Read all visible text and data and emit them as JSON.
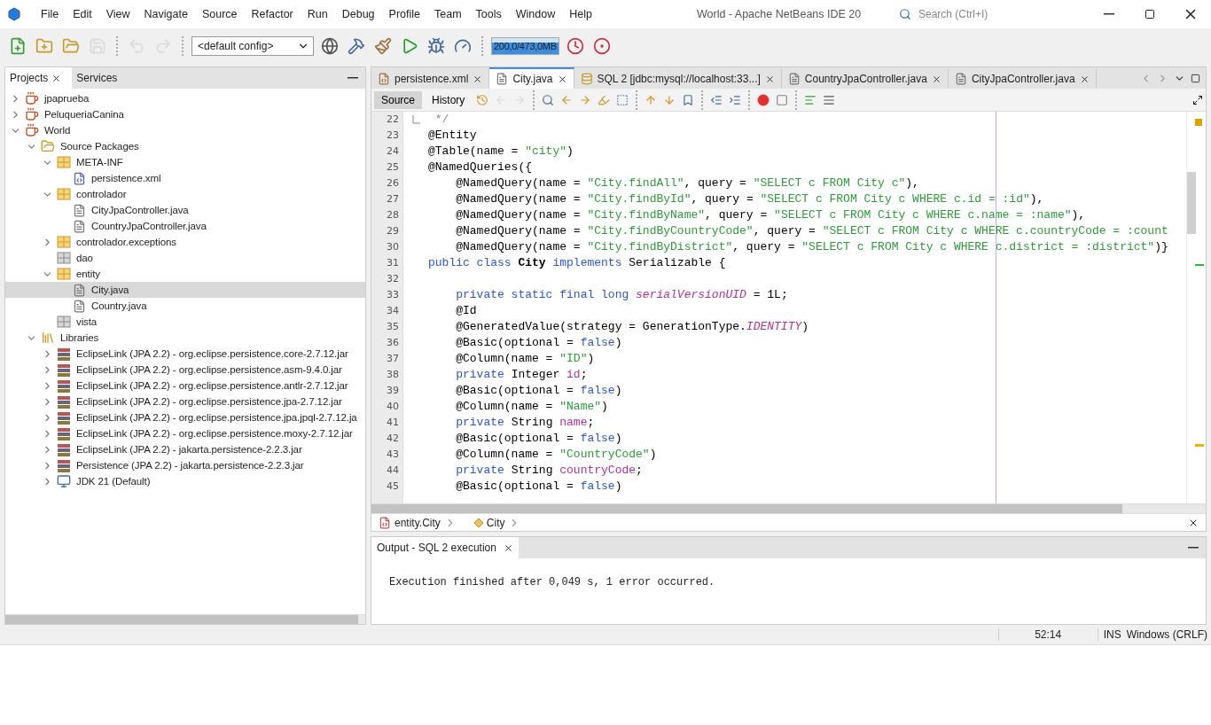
{
  "window": {
    "title": "World - Apache NetBeans IDE 20",
    "search_placeholder": "Search (Ctrl+I)"
  },
  "menu": [
    "File",
    "Edit",
    "View",
    "Navigate",
    "Source",
    "Refactor",
    "Run",
    "Debug",
    "Profile",
    "Team",
    "Tools",
    "Window",
    "Help"
  ],
  "toolbar": {
    "buttons": [
      {
        "kind": "new-file",
        "disabled": false
      },
      {
        "kind": "new-project",
        "disabled": false
      },
      {
        "kind": "open-project",
        "disabled": false
      },
      {
        "kind": "save-all",
        "disabled": true
      },
      {
        "kind": "sep"
      },
      {
        "kind": "undo",
        "disabled": true
      },
      {
        "kind": "redo",
        "disabled": true
      },
      {
        "kind": "sep"
      },
      {
        "kind": "config"
      },
      {
        "kind": "globe",
        "disabled": false
      },
      {
        "kind": "build",
        "disabled": false
      },
      {
        "kind": "clean-build",
        "disabled": false
      },
      {
        "kind": "run",
        "disabled": false
      },
      {
        "kind": "debug",
        "disabled": false
      },
      {
        "kind": "profile",
        "disabled": false
      },
      {
        "kind": "sep"
      },
      {
        "kind": "memory"
      },
      {
        "kind": "profiler-a",
        "disabled": false
      },
      {
        "kind": "profiler-b",
        "disabled": false
      }
    ],
    "config": "<default config>",
    "memory": "200,0/473,0MB"
  },
  "project_panel": {
    "tabs": [
      {
        "label": "Projects",
        "selected": true
      },
      {
        "label": "Services",
        "selected": false
      }
    ],
    "tree": [
      {
        "label": "jpaprueba",
        "kind": "project",
        "expanded": false,
        "selected": false
      },
      {
        "label": "PeluqueriaCanina",
        "kind": "project",
        "expanded": false,
        "selected": false
      },
      {
        "label": "World",
        "kind": "project",
        "expanded": true,
        "selected": false,
        "children": [
          {
            "label": "Source Packages",
            "kind": "source-packages",
            "expanded": true,
            "selected": false,
            "children": [
              {
                "label": "META-INF",
                "kind": "package",
                "expanded": true,
                "selected": false,
                "children": [
                  {
                    "label": "persistence.xml",
                    "kind": "xml-file",
                    "selected": false
                  }
                ]
              },
              {
                "label": "controlador",
                "kind": "package",
                "expanded": true,
                "selected": false,
                "children": [
                  {
                    "label": "CityJpaController.java",
                    "kind": "java-file",
                    "selected": false
                  },
                  {
                    "label": "CountryJpaController.java",
                    "kind": "java-file",
                    "selected": false
                  }
                ]
              },
              {
                "label": "controlador.exceptions",
                "kind": "package",
                "expanded": false,
                "selected": false
              },
              {
                "label": "dao",
                "kind": "empty-package",
                "selected": false
              },
              {
                "label": "entity",
                "kind": "package",
                "expanded": true,
                "selected": false,
                "children": [
                  {
                    "label": "City.java",
                    "kind": "java-file",
                    "selected": true
                  },
                  {
                    "label": "Country.java",
                    "kind": "java-file",
                    "selected": false
                  }
                ]
              },
              {
                "label": "vista",
                "kind": "empty-package",
                "selected": false
              }
            ]
          },
          {
            "label": "Libraries",
            "kind": "libraries",
            "expanded": true,
            "selected": false,
            "children": [
              {
                "label": "EclipseLink (JPA 2.2) - org.eclipse.persistence.core-2.7.12.jar",
                "kind": "jar",
                "expanded": false,
                "selected": false
              },
              {
                "label": "EclipseLink (JPA 2.2) - org.eclipse.persistence.asm-9.4.0.jar",
                "kind": "jar",
                "expanded": false,
                "selected": false
              },
              {
                "label": "EclipseLink (JPA 2.2) - org.eclipse.persistence.antlr-2.7.12.jar",
                "kind": "jar",
                "expanded": false,
                "selected": false
              },
              {
                "label": "EclipseLink (JPA 2.2) - org.eclipse.persistence.jpa-2.7.12.jar",
                "kind": "jar",
                "expanded": false,
                "selected": false
              },
              {
                "label": "EclipseLink (JPA 2.2) - org.eclipse.persistence.jpa.jpql-2.7.12.ja",
                "kind": "jar",
                "expanded": false,
                "selected": false
              },
              {
                "label": "EclipseLink (JPA 2.2) - org.eclipse.persistence.moxy-2.7.12.jar",
                "kind": "jar",
                "expanded": false,
                "selected": false
              },
              {
                "label": "EclipseLink (JPA 2.2) - jakarta.persistence-2.2.3.jar",
                "kind": "jar",
                "expanded": false,
                "selected": false
              },
              {
                "label": "Persistence (JPA 2.2) - jakarta.persistence-2.2.3.jar",
                "kind": "jar",
                "expanded": false,
                "selected": false
              },
              {
                "label": "JDK 21 (Default)",
                "kind": "jdk",
                "expanded": false,
                "selected": false
              }
            ]
          }
        ]
      }
    ]
  },
  "editor": {
    "tabs": [
      {
        "label": "persistence.xml",
        "kind": "xml",
        "selected": false
      },
      {
        "label": "City.java",
        "kind": "java",
        "selected": true
      },
      {
        "label": "SQL 2 [jdbc:mysql://localhost:33...]",
        "kind": "sql",
        "selected": false
      },
      {
        "label": "CountryJpaController.java",
        "kind": "java",
        "selected": false
      },
      {
        "label": "CityJpaController.java",
        "kind": "java",
        "selected": false
      }
    ],
    "view_tabs": [
      {
        "label": "Source",
        "selected": true
      },
      {
        "label": "History",
        "selected": false
      }
    ],
    "tools": [
      {
        "kind": "last-edit",
        "disabled": false
      },
      {
        "kind": "back",
        "disabled": true
      },
      {
        "kind": "forward",
        "disabled": true
      },
      {
        "kind": "sep"
      },
      {
        "kind": "find",
        "disabled": false
      },
      {
        "kind": "find-prev",
        "disabled": false
      },
      {
        "kind": "find-next",
        "disabled": false
      },
      {
        "kind": "highlight",
        "disabled": false
      },
      {
        "kind": "rect-select",
        "disabled": false
      },
      {
        "kind": "sep"
      },
      {
        "kind": "prev-bookmark",
        "disabled": false
      },
      {
        "kind": "next-bookmark",
        "disabled": false
      },
      {
        "kind": "toggle-bookmark",
        "disabled": false
      },
      {
        "kind": "sep"
      },
      {
        "kind": "shift-left",
        "disabled": false
      },
      {
        "kind": "shift-right",
        "disabled": false
      },
      {
        "kind": "sep"
      },
      {
        "kind": "record",
        "disabled": false
      },
      {
        "kind": "stop",
        "disabled": false
      },
      {
        "kind": "sep"
      },
      {
        "kind": "comment",
        "disabled": false
      },
      {
        "kind": "uncomment",
        "disabled": false
      }
    ],
    "lines": [
      {
        "n": "22",
        "fold": true,
        "tokens": [
          {
            "kind": "c",
            "text": " */"
          }
        ]
      },
      {
        "n": "23",
        "tokens": [
          {
            "kind": "p",
            "text": "@Entity"
          }
        ]
      },
      {
        "n": "24",
        "tokens": [
          {
            "kind": "p",
            "text": "@Table(name = "
          },
          {
            "kind": "s",
            "text": "\"city\""
          },
          {
            "kind": "p",
            "text": ")"
          }
        ]
      },
      {
        "n": "25",
        "tokens": [
          {
            "kind": "p",
            "text": "@NamedQueries({"
          }
        ]
      },
      {
        "n": "26",
        "tokens": [
          {
            "kind": "p",
            "text": "    @NamedQuery(name = "
          },
          {
            "kind": "s",
            "text": "\"City.findAll\""
          },
          {
            "kind": "p",
            "text": ", query = "
          },
          {
            "kind": "s",
            "text": "\"SELECT c FROM City c\""
          },
          {
            "kind": "p",
            "text": "),"
          }
        ]
      },
      {
        "n": "27",
        "tokens": [
          {
            "kind": "p",
            "text": "    @NamedQuery(name = "
          },
          {
            "kind": "s",
            "text": "\"City.findById\""
          },
          {
            "kind": "p",
            "text": ", query = "
          },
          {
            "kind": "s",
            "text": "\"SELECT c FROM City c WHERE c.id = :id\""
          },
          {
            "kind": "p",
            "text": "),"
          }
        ]
      },
      {
        "n": "28",
        "tokens": [
          {
            "kind": "p",
            "text": "    @NamedQuery(name = "
          },
          {
            "kind": "s",
            "text": "\"City.findByName\""
          },
          {
            "kind": "p",
            "text": ", query = "
          },
          {
            "kind": "s",
            "text": "\"SELECT c FROM City c WHERE c.name = :name\""
          },
          {
            "kind": "p",
            "text": "),"
          }
        ]
      },
      {
        "n": "29",
        "tokens": [
          {
            "kind": "p",
            "text": "    @NamedQuery(name = "
          },
          {
            "kind": "s",
            "text": "\"City.findByCountryCode\""
          },
          {
            "kind": "p",
            "text": ", query = "
          },
          {
            "kind": "s",
            "text": "\"SELECT c FROM City c WHERE c.countryCode = :count"
          }
        ]
      },
      {
        "n": "30",
        "tokens": [
          {
            "kind": "p",
            "text": "    @NamedQuery(name = "
          },
          {
            "kind": "s",
            "text": "\"City.findByDistrict\""
          },
          {
            "kind": "p",
            "text": ", query = "
          },
          {
            "kind": "s",
            "text": "\"SELECT c FROM City c WHERE c.district = :district\""
          },
          {
            "kind": "p",
            "text": ")}"
          }
        ]
      },
      {
        "n": "31",
        "tokens": [
          {
            "kind": "k",
            "text": "public class "
          },
          {
            "kind": "b",
            "text": "City"
          },
          {
            "kind": "k",
            "text": " implements"
          },
          {
            "kind": "p",
            "text": " Serializable {"
          }
        ]
      },
      {
        "n": "32"
      },
      {
        "n": "33",
        "tokens": [
          {
            "kind": "k",
            "text": "    private static final long "
          },
          {
            "kind": "i",
            "text": "serialVersionUID"
          },
          {
            "kind": "p",
            "text": " = 1L;"
          }
        ]
      },
      {
        "n": "34",
        "tokens": [
          {
            "kind": "p",
            "text": "    @Id"
          }
        ]
      },
      {
        "n": "35",
        "tokens": [
          {
            "kind": "p",
            "text": "    @GeneratedValue(strategy = GenerationType."
          },
          {
            "kind": "i",
            "text": "IDENTITY"
          },
          {
            "kind": "p",
            "text": ")"
          }
        ]
      },
      {
        "n": "36",
        "tokens": [
          {
            "kind": "p",
            "text": "    @Basic(optional = "
          },
          {
            "kind": "k",
            "text": "false"
          },
          {
            "kind": "p",
            "text": ")"
          }
        ]
      },
      {
        "n": "37",
        "tokens": [
          {
            "kind": "p",
            "text": "    @Column(name = "
          },
          {
            "kind": "s",
            "text": "\"ID\""
          },
          {
            "kind": "p",
            "text": ")"
          }
        ]
      },
      {
        "n": "38",
        "tokens": [
          {
            "kind": "k",
            "text": "    private"
          },
          {
            "kind": "p",
            "text": " Integer "
          },
          {
            "kind": "f",
            "text": "id"
          },
          {
            "kind": "p",
            "text": ";"
          }
        ]
      },
      {
        "n": "39",
        "tokens": [
          {
            "kind": "p",
            "text": "    @Basic(optional = "
          },
          {
            "kind": "k",
            "text": "false"
          },
          {
            "kind": "p",
            "text": ")"
          }
        ]
      },
      {
        "n": "40",
        "tokens": [
          {
            "kind": "p",
            "text": "    @Column(name = "
          },
          {
            "kind": "s",
            "text": "\"Name\""
          },
          {
            "kind": "p",
            "text": ")"
          }
        ]
      },
      {
        "n": "41",
        "tokens": [
          {
            "kind": "k",
            "text": "    private"
          },
          {
            "kind": "p",
            "text": " String "
          },
          {
            "kind": "f",
            "text": "name"
          },
          {
            "kind": "p",
            "text": ";"
          }
        ]
      },
      {
        "n": "42",
        "tokens": [
          {
            "kind": "p",
            "text": "    @Basic(optional = "
          },
          {
            "kind": "k",
            "text": "false"
          },
          {
            "kind": "p",
            "text": ")"
          }
        ]
      },
      {
        "n": "43",
        "tokens": [
          {
            "kind": "p",
            "text": "    @Column(name = "
          },
          {
            "kind": "s",
            "text": "\"CountryCode\""
          },
          {
            "kind": "p",
            "text": ")"
          }
        ]
      },
      {
        "n": "44",
        "tokens": [
          {
            "kind": "k",
            "text": "    private"
          },
          {
            "kind": "p",
            "text": " String "
          },
          {
            "kind": "f",
            "text": "countryCode"
          },
          {
            "kind": "p",
            "text": ";"
          }
        ]
      },
      {
        "n": "45",
        "tokens": [
          {
            "kind": "p",
            "text": "    @Basic(optional = "
          },
          {
            "kind": "k",
            "text": "false"
          },
          {
            "kind": "p",
            "text": ")"
          }
        ]
      }
    ],
    "breadcrumb": [
      {
        "label": "entity.City",
        "kind": "class-file"
      },
      {
        "label": "City",
        "kind": "class"
      }
    ]
  },
  "output": {
    "tab": "Output - SQL 2 execution",
    "text": "Execution finished after 0,049 s, 1 error occurred."
  },
  "status_bar": {
    "position": "52:14",
    "mode": "INS",
    "line_ending": "Windows (CRLF)"
  }
}
